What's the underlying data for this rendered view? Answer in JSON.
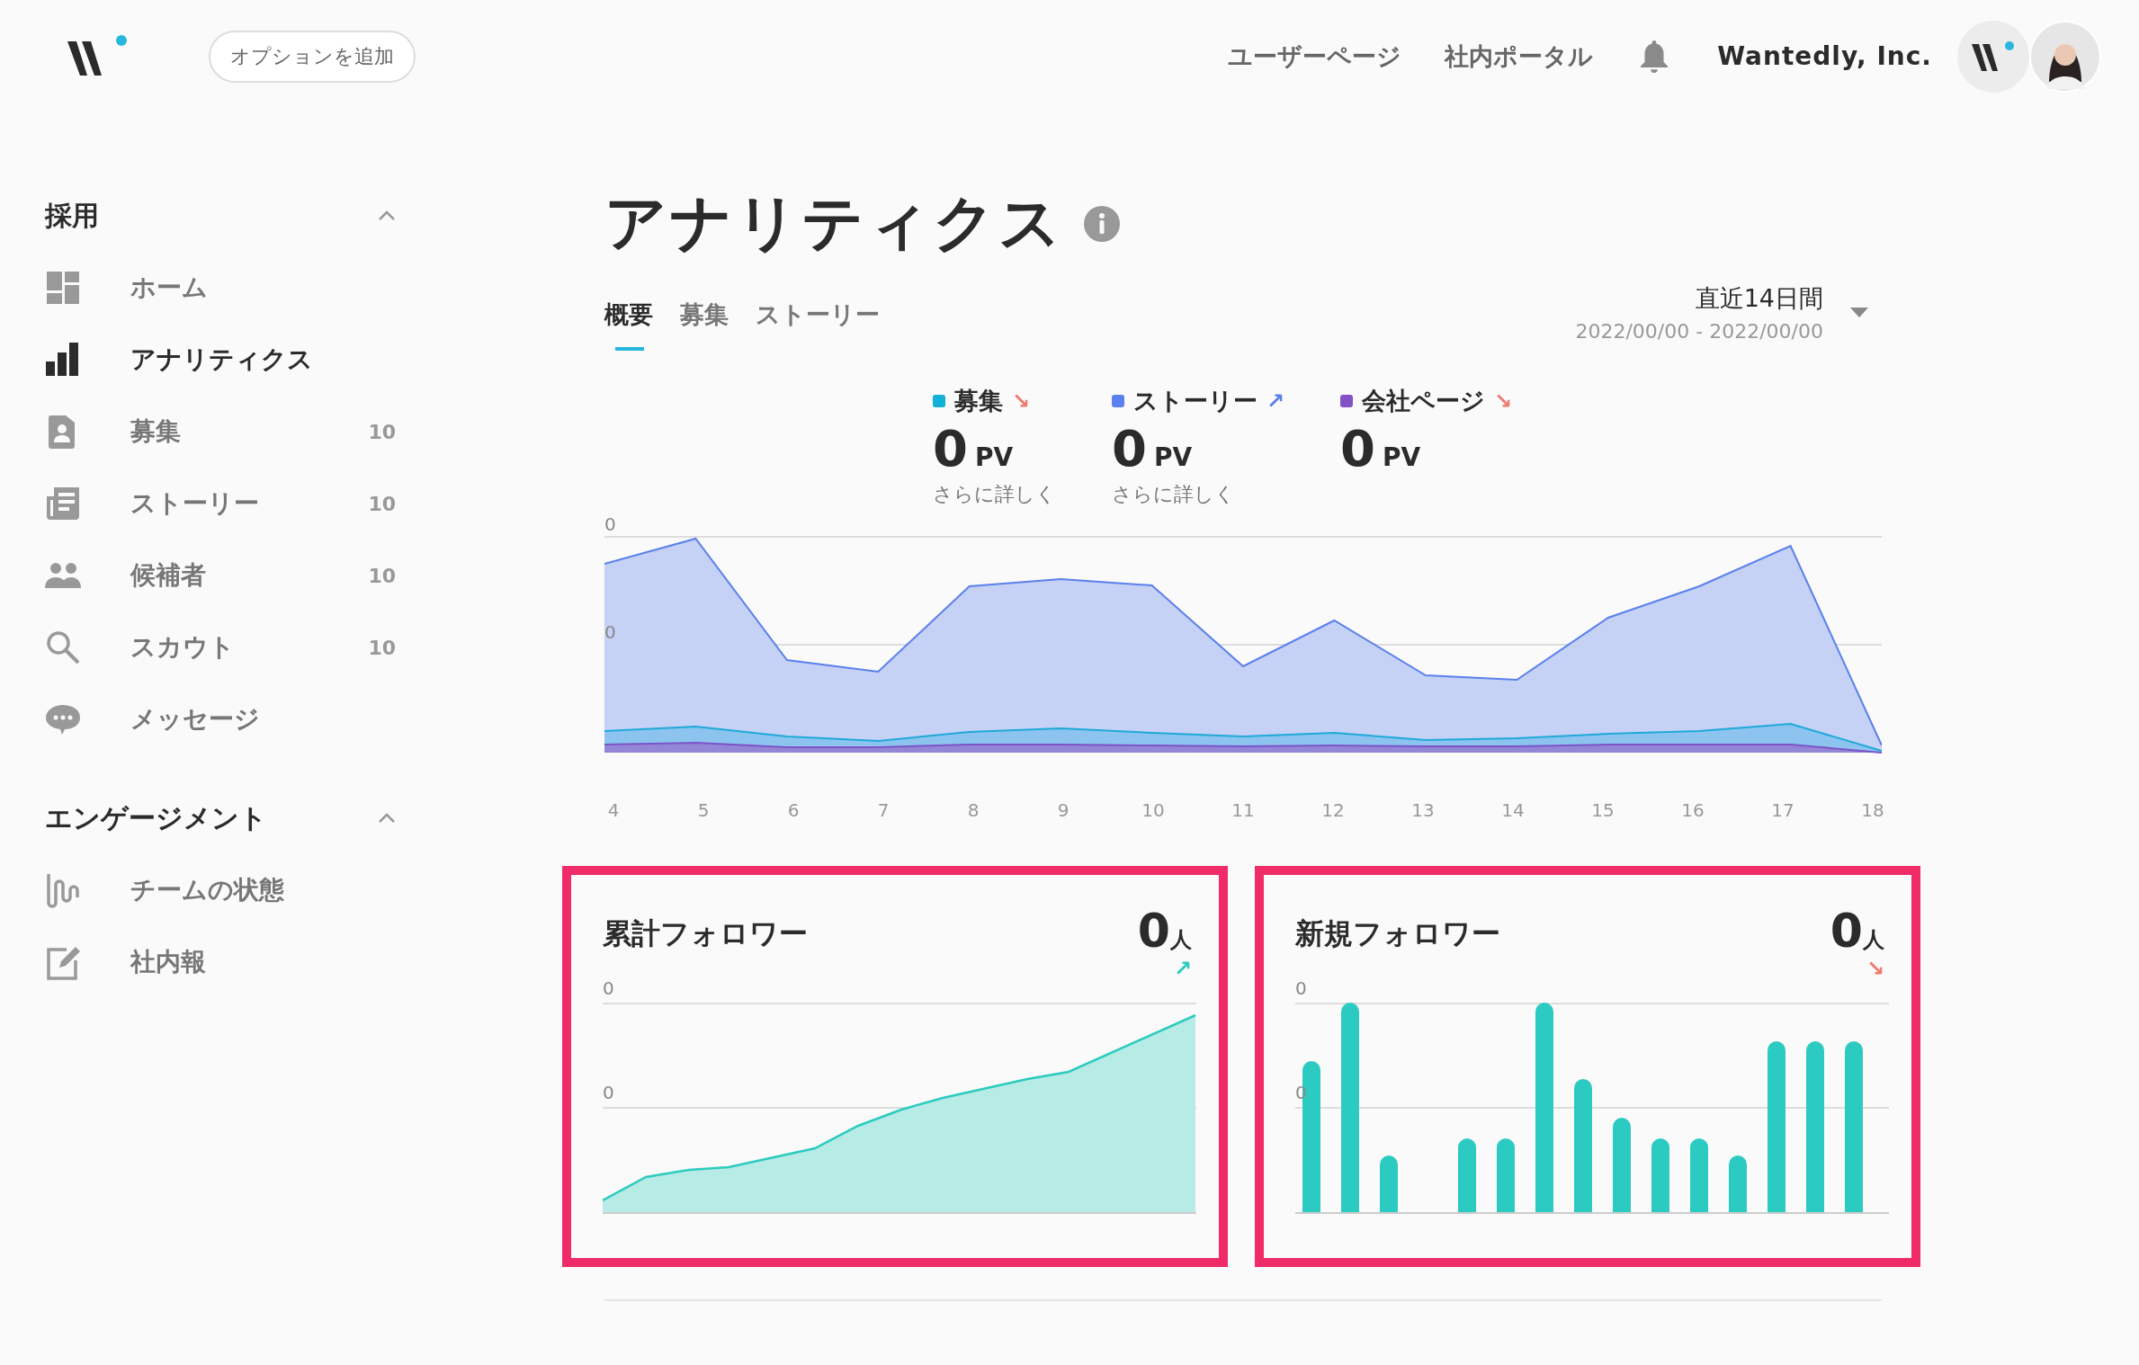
{
  "header": {
    "option_button": "オプションを追加",
    "nav_links": [
      "ユーザーページ",
      "社内ポータル"
    ],
    "company": "Wantedly, Inc."
  },
  "sidebar": {
    "sections": [
      {
        "title": "採用",
        "expanded": true,
        "items": [
          {
            "kind": "dashboard",
            "label": "ホーム",
            "selected": false
          },
          {
            "kind": "bars",
            "label": "アナリティクス",
            "selected": true
          },
          {
            "kind": "badge",
            "label": "募集",
            "selected": false,
            "count": "10"
          },
          {
            "kind": "newspaper",
            "label": "ストーリー",
            "selected": false,
            "count": "10"
          },
          {
            "kind": "people",
            "label": "候補者",
            "selected": false,
            "count": "10"
          },
          {
            "kind": "search",
            "label": "スカウト",
            "selected": false,
            "count": "10"
          },
          {
            "kind": "chat",
            "label": "メッセージ",
            "selected": false
          }
        ]
      },
      {
        "title": "エンゲージメント",
        "expanded": true,
        "items": [
          {
            "kind": "wave",
            "label": "チームの状態",
            "selected": false
          },
          {
            "kind": "edit",
            "label": "社内報",
            "selected": false
          }
        ]
      }
    ]
  },
  "page": {
    "title": "アナリティクス",
    "tabs": [
      {
        "label": "概要",
        "selected": true
      },
      {
        "label": "募集",
        "selected": false
      },
      {
        "label": "ストーリー",
        "selected": false
      }
    ],
    "period": {
      "label": "直近14日間",
      "range": "2022/00/00 - 2022/00/00"
    }
  },
  "overview": {
    "legend": [
      {
        "name": "募集",
        "color": "#12b1d6",
        "trend": {
          "arrow": "↘",
          "color": "#f07a6e"
        },
        "value": "0",
        "unit": "PV",
        "link": "さらに詳しく"
      },
      {
        "name": "ストーリー",
        "color": "#5b80ec",
        "trend": {
          "arrow": "↗",
          "color": "#5b80ec"
        },
        "value": "0",
        "unit": "PV",
        "link": "さらに詳しく"
      },
      {
        "name": "会社ページ",
        "color": "#8352c6",
        "trend": {
          "arrow": "↘",
          "color": "#f07a6e"
        },
        "value": "0",
        "unit": "PV"
      }
    ],
    "y_ticks": [
      "0",
      "0"
    ],
    "x_labels": [
      "4",
      "5",
      "6",
      "7",
      "8",
      "9",
      "10",
      "11",
      "12",
      "13",
      "14",
      "15",
      "16",
      "17",
      "18"
    ]
  },
  "cards": [
    {
      "kind": "area",
      "title": "累計フォロワー",
      "value": "0",
      "unit": "人",
      "trend": {
        "arrow": "↗",
        "color": "#2ccbbf"
      },
      "y_ticks": [
        "0",
        "0"
      ]
    },
    {
      "kind": "bar",
      "title": "新規フォロワー",
      "value": "0",
      "unit": "人",
      "trend": {
        "arrow": "↘",
        "color": "#f07a6e"
      },
      "y_ticks": [
        "0",
        "0"
      ]
    }
  ]
}
